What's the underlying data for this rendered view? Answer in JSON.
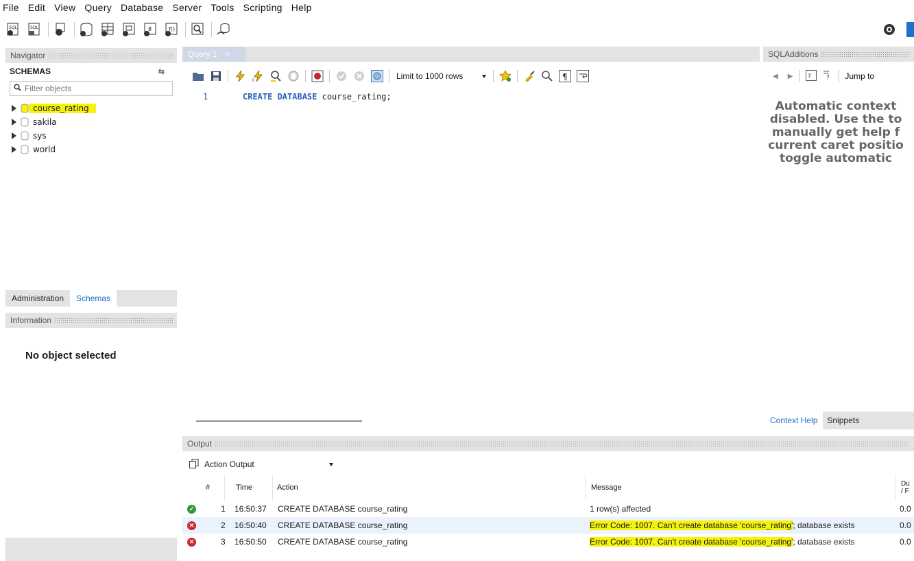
{
  "menu": [
    "File",
    "Edit",
    "View",
    "Query",
    "Database",
    "Server",
    "Tools",
    "Scripting",
    "Help"
  ],
  "navigator": {
    "header": "Navigator",
    "schemas_label": "SCHEMAS",
    "filter_placeholder": "Filter objects",
    "schemas": [
      "course_rating",
      "sakila",
      "sys",
      "world"
    ],
    "tabs": [
      "Administration",
      "Schemas"
    ],
    "active_tab": "Schemas"
  },
  "information": {
    "header": "Information",
    "empty_text": "No object selected"
  },
  "editor": {
    "tab_label": "Query 1",
    "limit_label": "Limit to 1000 rows",
    "line_number": "1",
    "code_keyword": "CREATE DATABASE",
    "code_rest": " course_rating;"
  },
  "sql_additions": {
    "header": "SQLAdditions",
    "jump_label": "Jump to",
    "help_lines": [
      "Automatic context",
      "disabled. Use the to",
      "manually get help f",
      "current caret positio",
      "toggle automatic"
    ],
    "tabs": [
      "Context Help",
      "Snippets"
    ],
    "active_tab": "Context Help"
  },
  "output": {
    "header": "Output",
    "selector": "Action Output",
    "columns": {
      "num": "#",
      "time": "Time",
      "action": "Action",
      "message": "Message",
      "duration_1": "Du",
      "duration_2": "/ F"
    },
    "rows": [
      {
        "status": "success",
        "num": "1",
        "time": "16:50:37",
        "action": "CREATE DATABASE course_rating",
        "message": "1 row(s) affected",
        "duration": "0.0"
      },
      {
        "status": "error",
        "num": "2",
        "time": "16:50:40",
        "action": "CREATE DATABASE course_rating",
        "message_hl": "Error Code: 1007. Can't create database 'course_rating'",
        "message_rest": "; database exists",
        "duration": "0.0"
      },
      {
        "status": "error",
        "num": "3",
        "time": "16:50:50",
        "action": "CREATE DATABASE course_rating",
        "message_hl": "Error Code: 1007. Can't create database 'course_rating'",
        "message_rest": "; database exists",
        "duration": "0.0"
      }
    ]
  },
  "colors": {
    "highlight": "#f7f20a",
    "accent_blue": "#1b6ec2",
    "success": "#2e9a3a",
    "error": "#c8282d"
  }
}
